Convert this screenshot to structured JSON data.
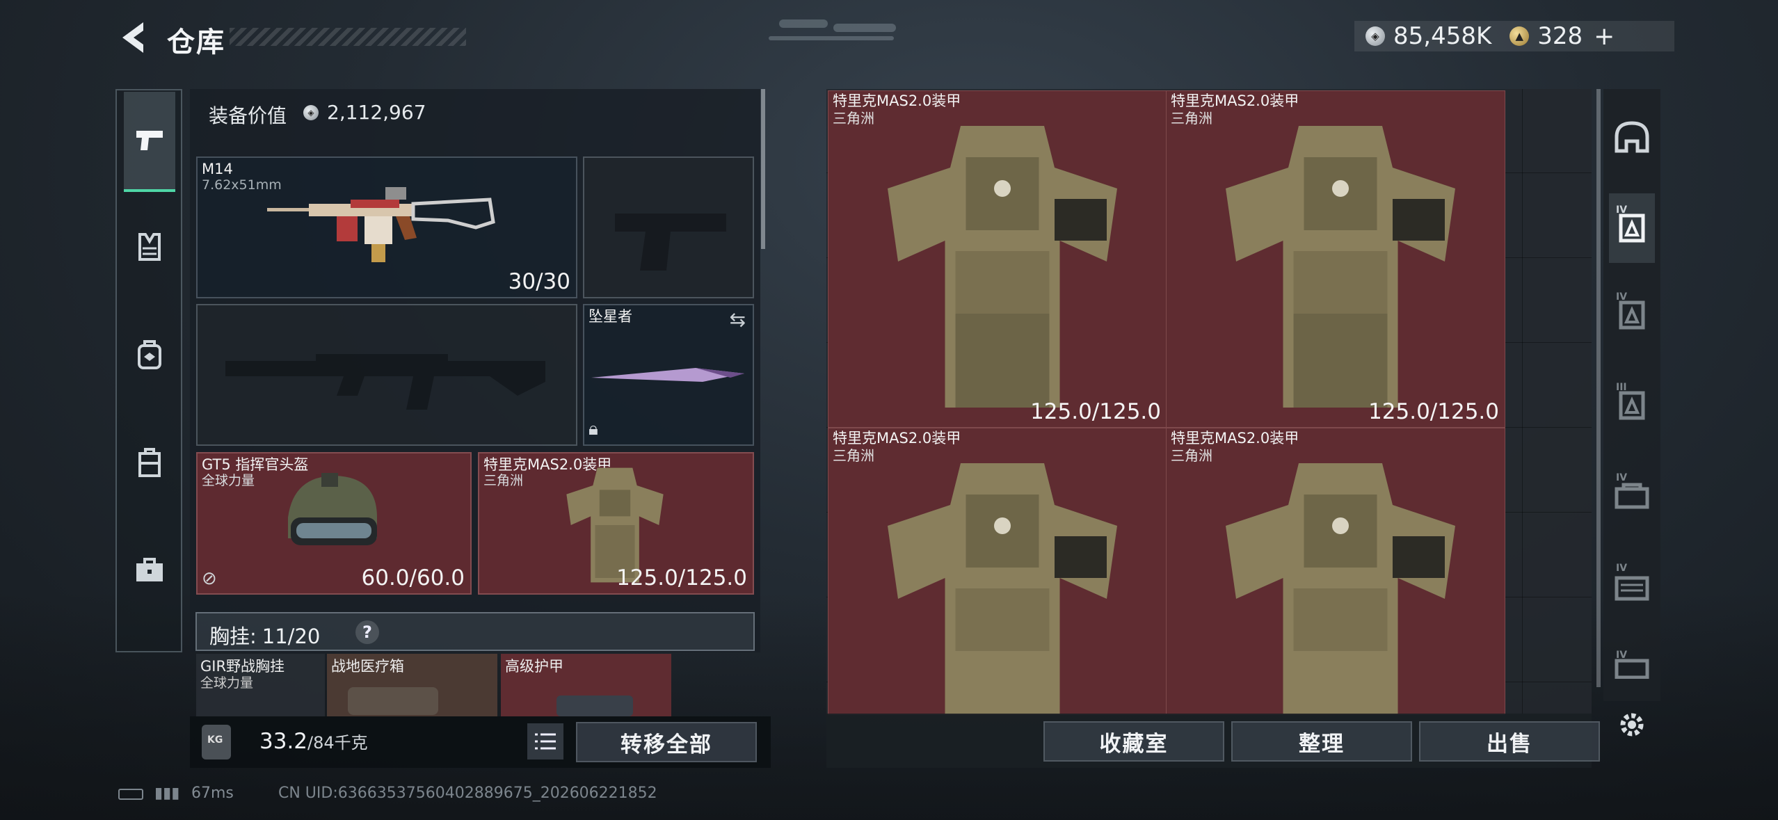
{
  "header": {
    "title": "仓库",
    "currency_1": "85,458K",
    "currency_2": "328",
    "currency_2_plus": "+"
  },
  "left_categories": [
    {
      "icon": "pistol-icon",
      "active": true
    },
    {
      "icon": "chest-rig-icon",
      "active": false
    },
    {
      "icon": "backpack-icon",
      "active": false
    },
    {
      "icon": "container-icon",
      "active": false
    },
    {
      "icon": "briefcase-icon",
      "active": false
    }
  ],
  "equipment": {
    "value_label": "装备价值",
    "value": "2,112,967",
    "primary_weapon": {
      "name": "M14",
      "caliber": "7.62x51mm",
      "ammo": "30/30"
    },
    "melee": {
      "name": "坠星者"
    },
    "helmet": {
      "name": "GT5 指挥官头盔",
      "brand": "全球力量",
      "durability": "60.0/60.0"
    },
    "armor": {
      "name": "特里克MAS2.0装甲",
      "brand": "三角洲",
      "durability": "125.0/125.0"
    },
    "chest_rig": {
      "label": "胸挂:",
      "capacity": "11/20",
      "help": "?"
    },
    "rig_items": [
      {
        "name": "GIR野战胸挂",
        "brand": "全球力量"
      },
      {
        "name": "战地医疗箱",
        "brand": ""
      },
      {
        "name": "高级护甲",
        "brand": ""
      }
    ]
  },
  "weight": {
    "current": "33.2",
    "max": "/84千克"
  },
  "buttons": {
    "transfer_all": "转移全部",
    "collection": "收藏室",
    "sort": "整理",
    "sell": "出售"
  },
  "storage_items": [
    {
      "name": "特里克MAS2.0装甲",
      "brand": "三角洲",
      "durability": "125.0/125.0"
    },
    {
      "name": "特里克MAS2.0装甲",
      "brand": "三角洲",
      "durability": "125.0/125.0"
    },
    {
      "name": "特里克MAS2.0装甲",
      "brand": "三角洲",
      "durability": ""
    },
    {
      "name": "特里克MAS2.0装甲",
      "brand": "三角洲",
      "durability": ""
    }
  ],
  "right_filters": [
    {
      "icon": "helmet-filter-icon",
      "tier": ""
    },
    {
      "icon": "armor-filter-icon",
      "tier": "IV"
    },
    {
      "icon": "armor-tier-iv-icon",
      "tier": "IV"
    },
    {
      "icon": "armor-tier-iii-icon",
      "tier": "III"
    },
    {
      "icon": "rig-tier-iv-icon",
      "tier": "IV"
    },
    {
      "icon": "backpack-tier-iv-icon",
      "tier": "IV"
    },
    {
      "icon": "backpack-tier-iv-2-icon",
      "tier": "IV"
    }
  ],
  "status_bar": {
    "ping": "67ms",
    "uid": "CN UID:636635375604028896​75_202606221852"
  },
  "colors": {
    "item_red": "#5f2c31",
    "accent_green": "#4fd6a6",
    "panel": "#181f26"
  }
}
